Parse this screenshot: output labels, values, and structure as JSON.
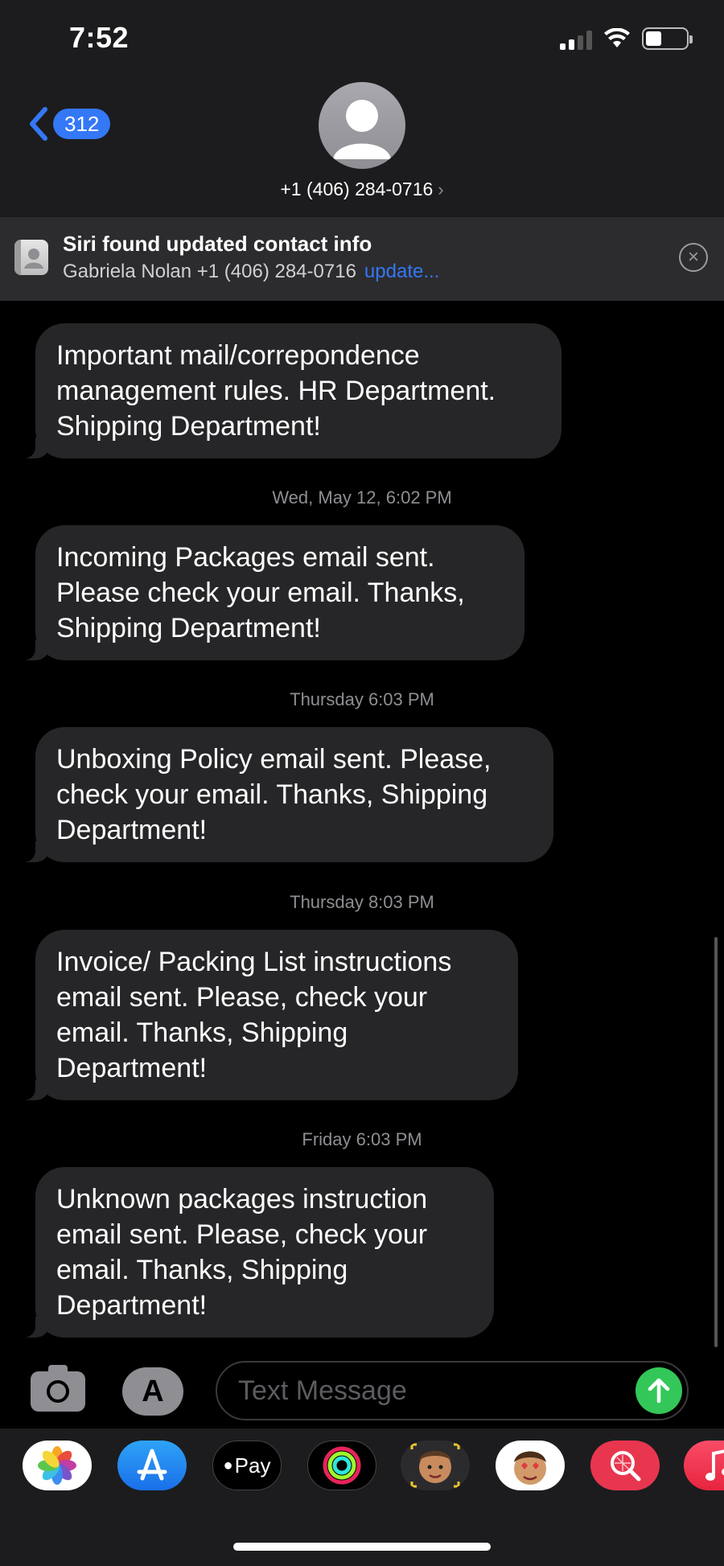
{
  "status_bar": {
    "time": "7:52"
  },
  "header": {
    "back_badge": "312",
    "contact": "+1 (406) 284-0716",
    "chevron": "›"
  },
  "siri_banner": {
    "title": "Siri found updated contact info",
    "subtitle": "Gabriela Nolan +1 (406) 284-0716",
    "link": "update..."
  },
  "messages": [
    {
      "timestamp": "",
      "text": "Important mail/correpondence management rules. HR Department. Shipping Department!"
    },
    {
      "timestamp": "Wed, May 12, 6:02 PM",
      "text": "Incoming Packages email sent. Please check your email. Thanks, Shipping Department!"
    },
    {
      "timestamp": "Thursday 6:03 PM",
      "text": "Unboxing Policy email sent. Please, check your email. Thanks, Shipping Department!"
    },
    {
      "timestamp": "Thursday 8:03 PM",
      "text": "Invoice/ Packing List instructions email sent. Please, check your email. Thanks, Shipping Department!"
    },
    {
      "timestamp": "Friday 6:03 PM",
      "text": "Unknown packages instruction email sent. Please, check your email. Thanks, Shipping Department!"
    }
  ],
  "composer": {
    "placeholder": "Text Message"
  },
  "app_drawer": {
    "items": [
      "photos-icon",
      "app-store-icon",
      "apple-pay-icon",
      "activity-icon",
      "memoji-icon",
      "animoji-icon",
      "search-images-icon",
      "music-icon"
    ],
    "apple_pay_label": "Pay"
  },
  "colors": {
    "accent": "#3478f6",
    "send": "#33c759",
    "bubble": "#262628"
  }
}
